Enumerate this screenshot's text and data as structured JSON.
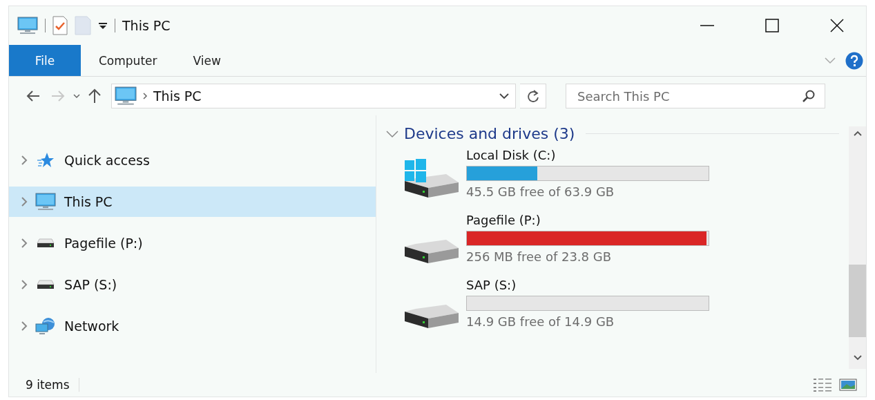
{
  "window": {
    "title": "This PC"
  },
  "ribbon": {
    "tabs": [
      {
        "label": "File",
        "selected": true
      },
      {
        "label": "Computer",
        "selected": false
      },
      {
        "label": "View",
        "selected": false
      }
    ]
  },
  "navigation": {
    "back_disabled": false,
    "forward_disabled": true
  },
  "address_bar": {
    "path": "This PC"
  },
  "search": {
    "placeholder": "Search This PC"
  },
  "sidebar": {
    "items": [
      {
        "label": "Quick access",
        "kind": "star",
        "expanded": false,
        "selected": false
      },
      {
        "label": "This PC",
        "kind": "pc",
        "expanded": false,
        "selected": true
      },
      {
        "label": "Pagefile (P:)",
        "kind": "drive",
        "expanded": false,
        "selected": false
      },
      {
        "label": "SAP (S:)",
        "kind": "drive",
        "expanded": false,
        "selected": false
      },
      {
        "label": "Network",
        "kind": "network",
        "expanded": false,
        "selected": false
      }
    ]
  },
  "content": {
    "group": {
      "title": "Devices and drives (3)",
      "expanded": true
    },
    "drives": [
      {
        "name": "Local Disk (C:)",
        "kind": "system",
        "level": 0.29,
        "color": "#26a0da",
        "free": "45.5 GB free of 63.9 GB"
      },
      {
        "name": "Pagefile (P:)",
        "kind": "plain",
        "level": 0.99,
        "color": "#da2626",
        "free": "256 MB free of 23.8 GB"
      },
      {
        "name": "SAP (S:)",
        "kind": "plain",
        "free": "14.9 GB free of 14.9 GB"
      }
    ]
  },
  "status_bar": {
    "count": "9 items"
  }
}
